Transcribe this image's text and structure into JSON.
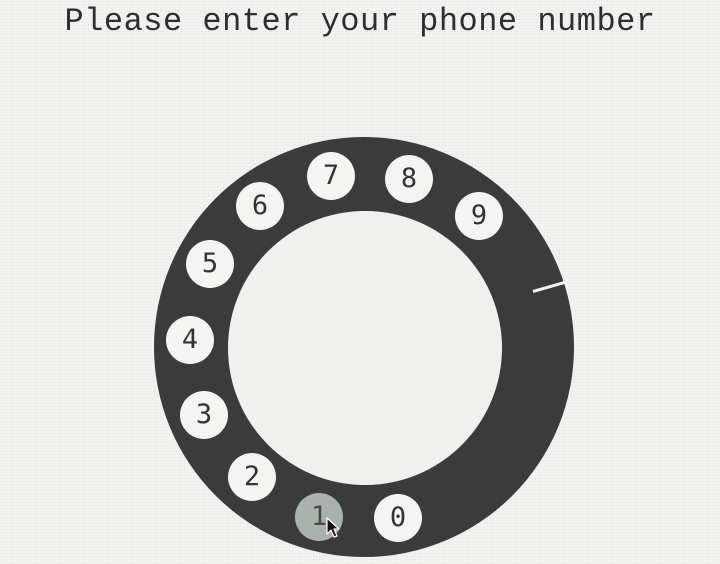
{
  "prompt": {
    "title": "Please enter your phone number"
  },
  "dial": {
    "digits": [
      {
        "label": "1",
        "active": true
      },
      {
        "label": "2",
        "active": false
      },
      {
        "label": "3",
        "active": false
      },
      {
        "label": "4",
        "active": false
      },
      {
        "label": "5",
        "active": false
      },
      {
        "label": "6",
        "active": false
      },
      {
        "label": "7",
        "active": false
      },
      {
        "label": "8",
        "active": false
      },
      {
        "label": "9",
        "active": false
      },
      {
        "label": "0",
        "active": false
      }
    ]
  },
  "colors": {
    "dial": "#3b3b3b",
    "hole": "#f4f4f2",
    "active_hole": "#a8b3ad",
    "text": "#2e2e2e"
  },
  "icons": {
    "cursor": "mouse-pointer-icon"
  }
}
